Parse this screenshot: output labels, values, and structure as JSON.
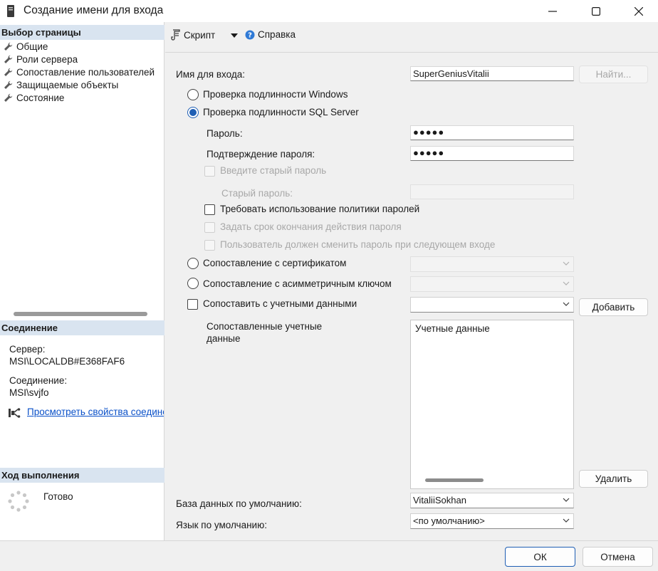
{
  "window": {
    "title": "Создание имени для входа"
  },
  "left": {
    "pages_header": "Выбор страницы",
    "pages": [
      {
        "label": "Общие",
        "selected": true
      },
      {
        "label": "Роли сервера"
      },
      {
        "label": "Сопоставление пользователей"
      },
      {
        "label": "Защищаемые объекты"
      },
      {
        "label": "Состояние"
      }
    ],
    "connection_header": "Соединение",
    "server_label": "Сервер:",
    "server_value": "MSI\\LOCALDB#E368FAF6",
    "connection_label": "Соединение:",
    "connection_value": "MSI\\svjfo",
    "view_props_link": "Просмотреть свойства соединения",
    "progress_header": "Ход выполнения",
    "progress_status": "Готово"
  },
  "toolbar": {
    "script_label": "Скрипт",
    "help_label": "Справка"
  },
  "form": {
    "login_name_label": "Имя для входа:",
    "login_name_value": "SuperGeniusVitalii",
    "search_button": "Найти...",
    "auth_windows": "Проверка подлинности Windows",
    "auth_sql": "Проверка подлинности SQL Server",
    "password_label": "Пароль:",
    "password_value": "●●●●●",
    "confirm_label": "Подтверждение пароля:",
    "confirm_value": "●●●●●",
    "old_password_check": "Введите старый пароль",
    "old_password_label": "Старый пароль:",
    "enforce_policy": "Требовать использование политики паролей",
    "enforce_expiration": "Задать срок окончания действия пароля",
    "must_change": "Пользователь должен сменить пароль при следующем входе",
    "map_certificate": "Сопоставление с сертификатом",
    "map_asym_key": "Сопоставление с асимметричным ключом",
    "map_credentials": "Сопоставить с учетными данными",
    "add_button": "Добавить",
    "mapped_credentials_label": "Сопоставленные учетные данные",
    "credentials_column": "Учетные данные",
    "delete_button": "Удалить",
    "default_db_label": "База данных по умолчанию:",
    "default_db_value": "VitaliiSokhan",
    "default_lang_label": "Язык по умолчанию:",
    "default_lang_value": "<по умолчанию>"
  },
  "footer": {
    "ok": "ОК",
    "cancel": "Отмена"
  },
  "colors": {
    "accent": "#1f5fb4",
    "section_header": "#d9e4f0",
    "link": "#0a50c8"
  }
}
